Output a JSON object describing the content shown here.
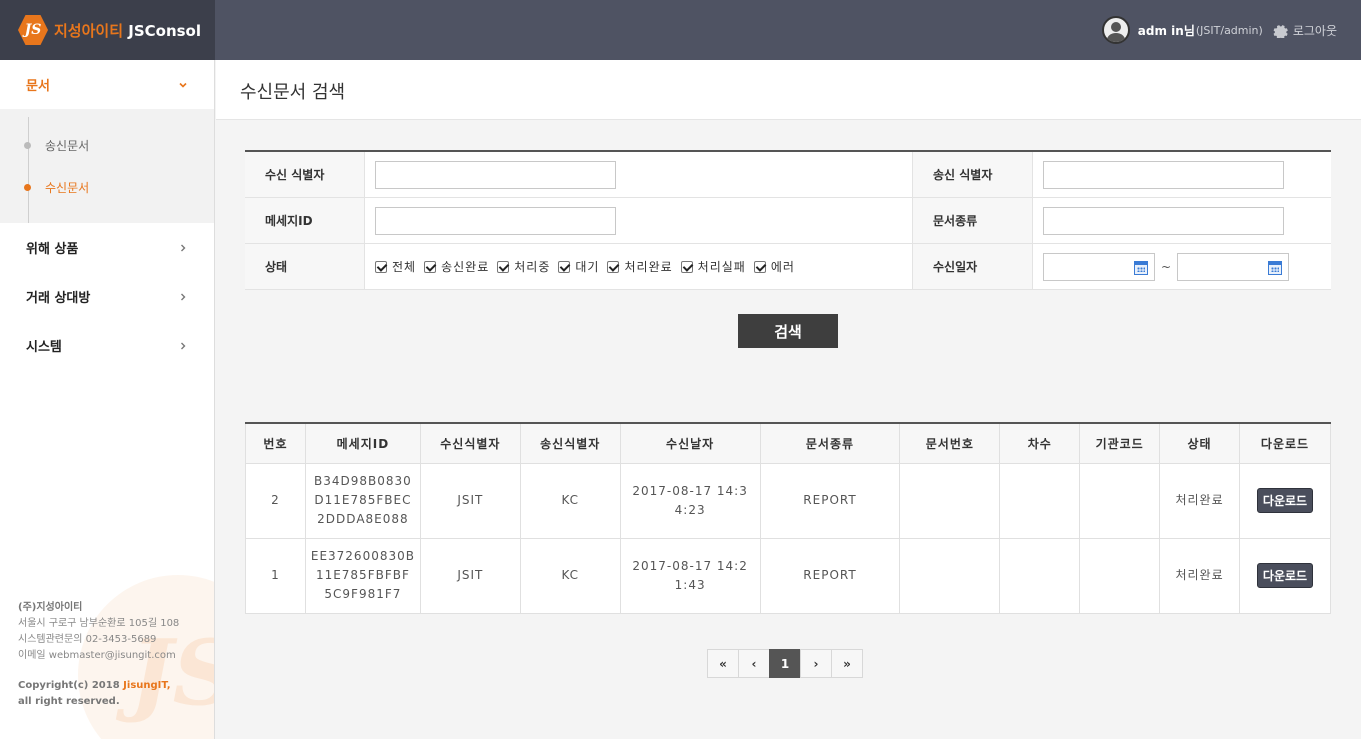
{
  "header": {
    "logo_mark": "JS",
    "logo_ko": "지성아이티",
    "logo_en": "JSConsol",
    "user_name": "adm in님",
    "user_sub": "(JSIT/admin)",
    "logout_label": "로그아웃"
  },
  "sidebar": {
    "menu": [
      {
        "label": "문서",
        "expanded": true
      },
      {
        "label": "위해 상품"
      },
      {
        "label": "거래 상대방"
      },
      {
        "label": "시스템"
      }
    ],
    "submenu": [
      {
        "label": "송신문서",
        "active": false
      },
      {
        "label": "수신문서",
        "active": true
      }
    ],
    "footer": {
      "company": "(주)지성아이티",
      "address": "서울시 구로구 남부순환로 105길 108",
      "phone": "시스템관련문의 02-3453-5689",
      "email": "이메일 webmaster@jisungit.com",
      "copyright_prefix": "Copyright(c) 2018 ",
      "copyright_brand": "JisungIT,",
      "copyright_suffix": "all right reserved."
    }
  },
  "page": {
    "title": "수신문서 검색"
  },
  "search": {
    "receiver_id_label": "수신 식별자",
    "sender_id_label": "송신 식별자",
    "message_id_label": "메세지ID",
    "doc_type_label": "문서종류",
    "status_label": "상태",
    "date_label": "수신일자",
    "receiver_id_value": "",
    "sender_id_value": "",
    "message_id_value": "",
    "doc_type_value": "",
    "date_from": "",
    "date_to": "",
    "date_sep": "~",
    "status_options": [
      {
        "label": "전체",
        "checked": true
      },
      {
        "label": "송신완료",
        "checked": true
      },
      {
        "label": "처리중",
        "checked": true
      },
      {
        "label": "대기",
        "checked": true
      },
      {
        "label": "처리완료",
        "checked": true
      },
      {
        "label": "처리실패",
        "checked": true
      },
      {
        "label": "에러",
        "checked": true
      }
    ],
    "search_button": "검색"
  },
  "results": {
    "columns": [
      "번호",
      "메세지ID",
      "수신식별자",
      "송신식별자",
      "수신날자",
      "문서종류",
      "문서번호",
      "차수",
      "기관코드",
      "상태",
      "다운로드"
    ],
    "rows": [
      {
        "no": "2",
        "message_id_l1": "B34D98B0830",
        "message_id_l2": "D11E785FBEC",
        "message_id_l3": "2DDDA8E088",
        "receiver": "JSIT",
        "sender": "KC",
        "date_l1": "2017-08-17 14:3",
        "date_l2": "4:23",
        "doc_type": "REPORT",
        "doc_no": "",
        "seq": "",
        "org_code": "",
        "status": "처리완료",
        "download": "다운로드"
      },
      {
        "no": "1",
        "message_id_l1": "EE372600830B",
        "message_id_l2": "11E785FBFBF",
        "message_id_l3": "5C9F981F7",
        "receiver": "JSIT",
        "sender": "KC",
        "date_l1": "2017-08-17 14:2",
        "date_l2": "1:43",
        "doc_type": "REPORT",
        "doc_no": "",
        "seq": "",
        "org_code": "",
        "status": "처리완료",
        "download": "다운로드"
      }
    ]
  },
  "pagination": {
    "first": "«",
    "prev": "‹",
    "current": "1",
    "next": "›",
    "last": "»"
  },
  "colors": {
    "accent": "#e8761c",
    "header_bg": "#4f5363",
    "logo_bg": "#3c3f4b"
  }
}
